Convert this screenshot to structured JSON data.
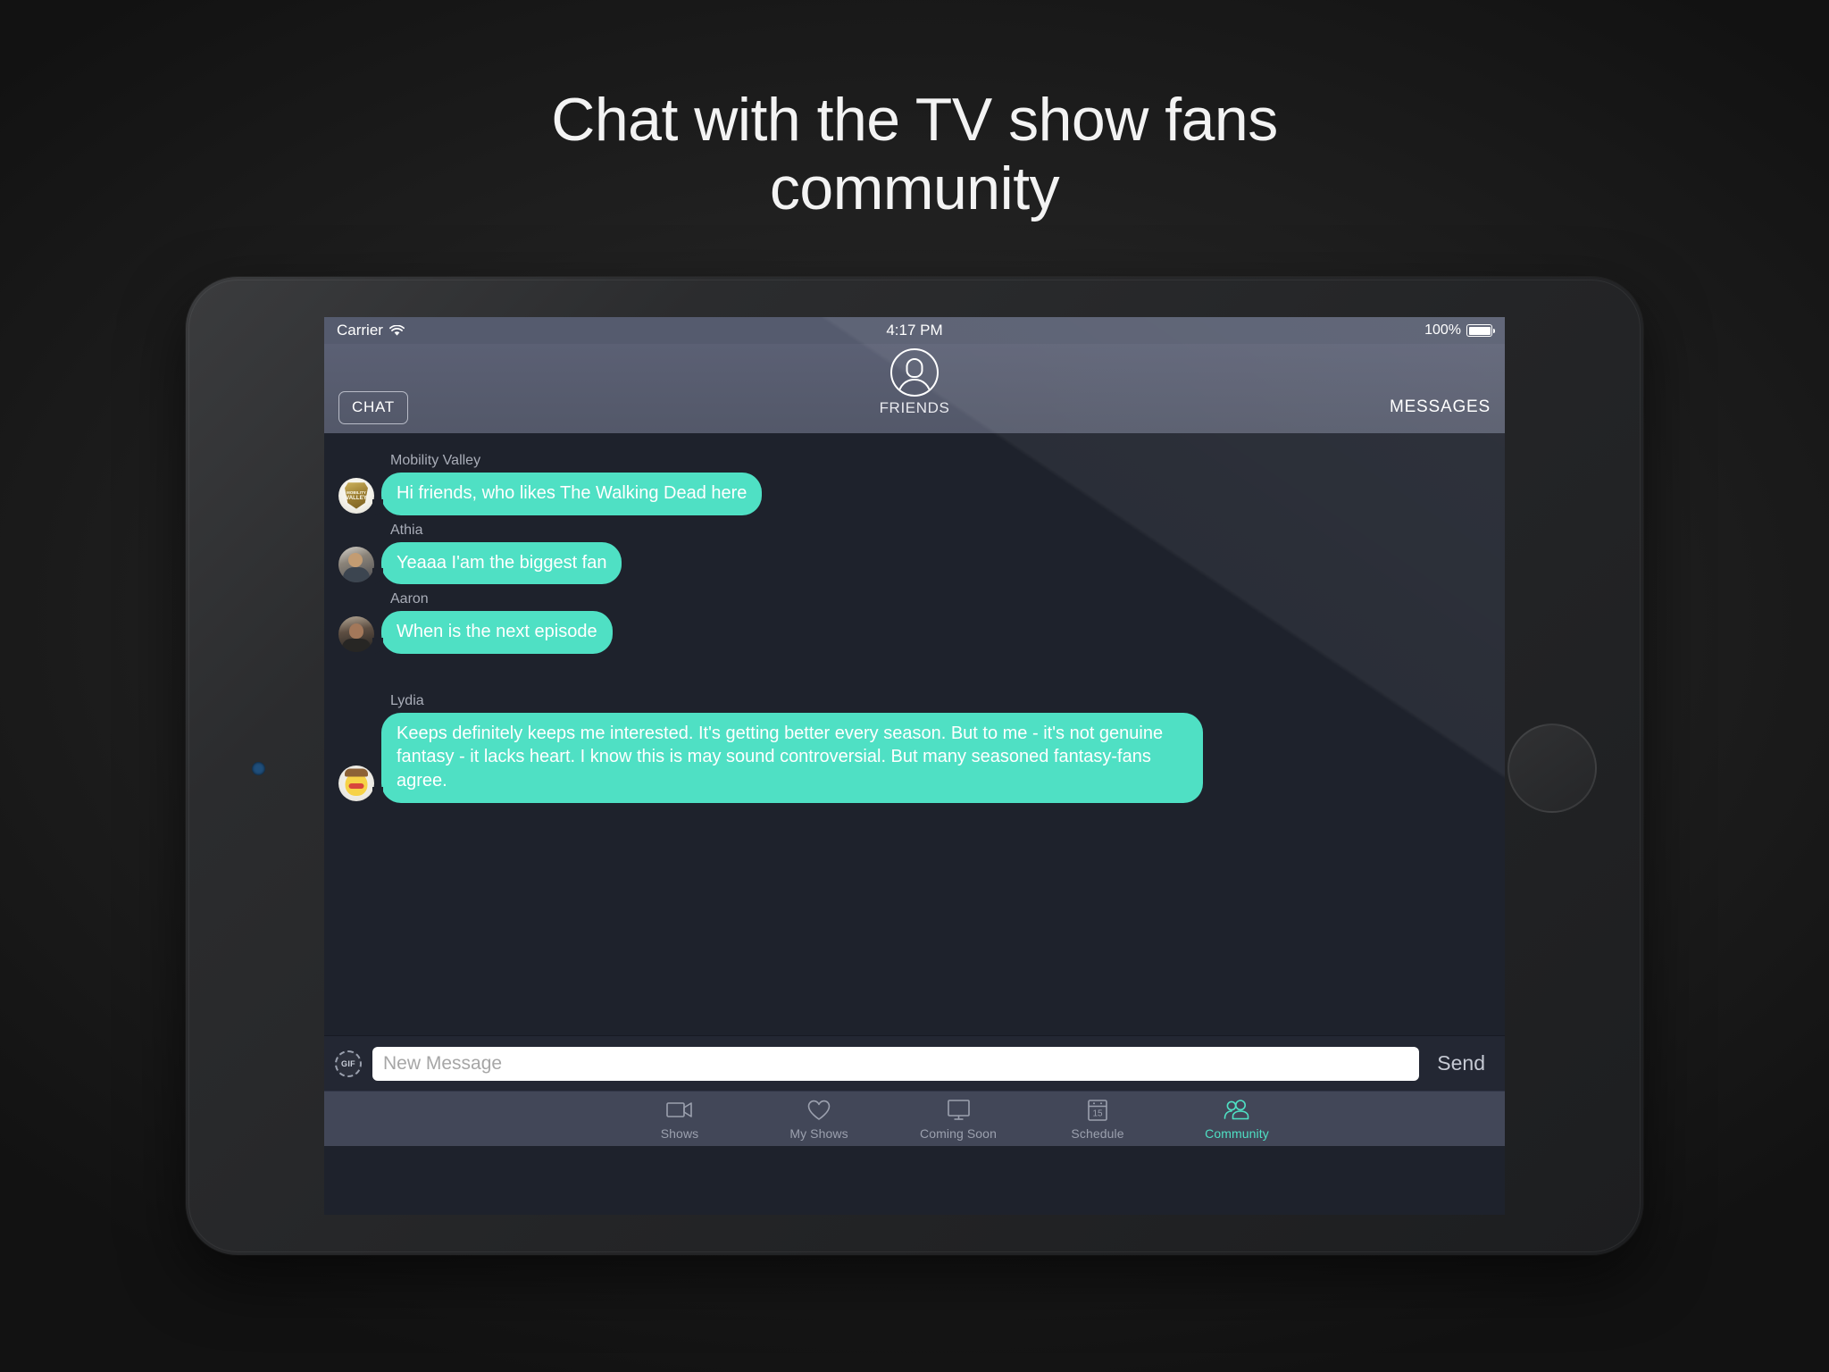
{
  "headline": {
    "line1": "Chat with the TV show fans",
    "line2": "community"
  },
  "device": {
    "camera_dot": "front-camera",
    "home_button": "home-button"
  },
  "status_bar": {
    "carrier": "Carrier",
    "wifi_icon": "wifi-icon",
    "time": "4:17 PM",
    "battery_percent": "100%",
    "battery_icon": "battery-full-icon"
  },
  "nav_bar": {
    "left_button": "CHAT",
    "title": "FRIENDS",
    "avatar_icon": "person-circle-icon",
    "right_button": "MESSAGES"
  },
  "chat": {
    "messages": [
      {
        "sender": "Mobility Valley",
        "text": "Hi friends, who likes The Walking Dead here",
        "avatar": "mobility-valley-badge-avatar"
      },
      {
        "sender": "Athia",
        "text": "Yeaaa I'am the biggest fan",
        "avatar": "athia-photo-avatar"
      },
      {
        "sender": "Aaron",
        "text": "When is the next episode",
        "avatar": "aaron-photo-avatar"
      },
      {
        "sender": "Lydia",
        "text": "Keeps definitely keeps me interested. It's getting better every season. But to me - it's not genuine fantasy - it lacks heart. I know this is may sound controversial. But many seasoned fantasy-fans agree.",
        "avatar": "lydia-pikachu-avatar"
      }
    ]
  },
  "composer": {
    "gif_label": "GIF",
    "input_value": "",
    "input_placeholder": "New Message",
    "send_label": "Send"
  },
  "tab_bar": {
    "tabs": [
      {
        "label": "Shows",
        "icon": "video-camera-icon",
        "active": false
      },
      {
        "label": "My Shows",
        "icon": "heart-icon",
        "active": false
      },
      {
        "label": "Coming Soon",
        "icon": "monitor-icon",
        "active": false
      },
      {
        "label": "Schedule",
        "icon": "calendar-15-icon",
        "active": false
      },
      {
        "label": "Community",
        "icon": "people-icon",
        "active": true
      }
    ]
  },
  "colors": {
    "accent": "#4fe0c4",
    "chat_background": "#1e222c",
    "nav_background": "#575c70",
    "tabbar_background": "#424758",
    "inactive_tab": "#9ba0ae"
  }
}
